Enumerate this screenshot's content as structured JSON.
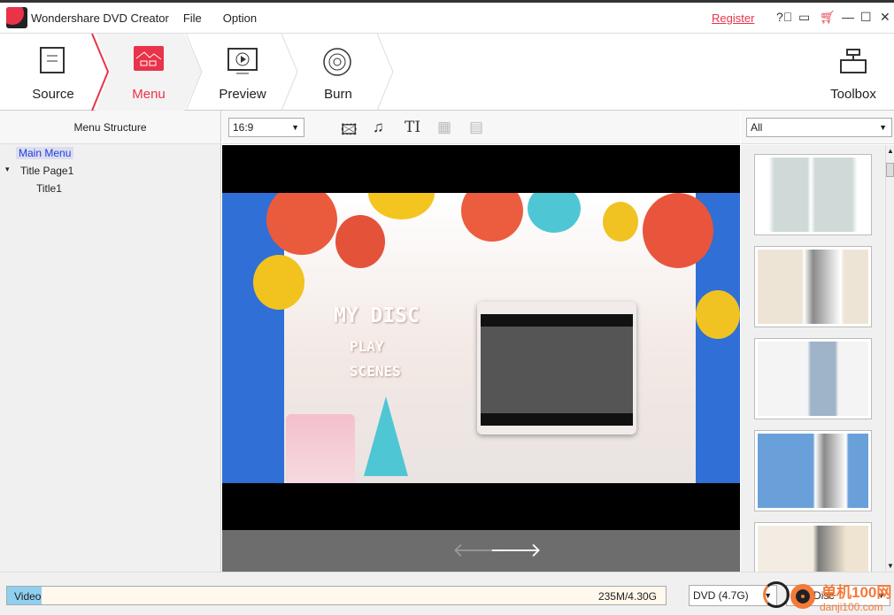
{
  "app": {
    "title": "Wondershare DVD Creator",
    "menu": [
      "File",
      "Option"
    ],
    "register": "Register"
  },
  "steps": [
    {
      "label": "Source"
    },
    {
      "label": "Menu",
      "active": true
    },
    {
      "label": "Preview"
    },
    {
      "label": "Burn"
    }
  ],
  "toolbox": "Toolbox",
  "left": {
    "header": "Menu Structure",
    "tree": [
      "Main Menu",
      "Title Page1",
      "Title1"
    ]
  },
  "center": {
    "aspect": "16:9",
    "menu_preview": {
      "title": "MY DISC",
      "items": [
        "PLAY",
        "SCENES"
      ]
    }
  },
  "right": {
    "filter": "All",
    "template_count_visible": 5
  },
  "bottom": {
    "bar_label": "Video",
    "usage": "235M/4.30G",
    "usage_fraction": 0.053,
    "disc_type": "DVD (4.7G)",
    "quality": "Disc"
  },
  "watermark": {
    "text1": "单机100网",
    "text2": "danji100.com"
  },
  "colors": {
    "accent": "#e8334a",
    "progress": "#8fd0f0"
  }
}
